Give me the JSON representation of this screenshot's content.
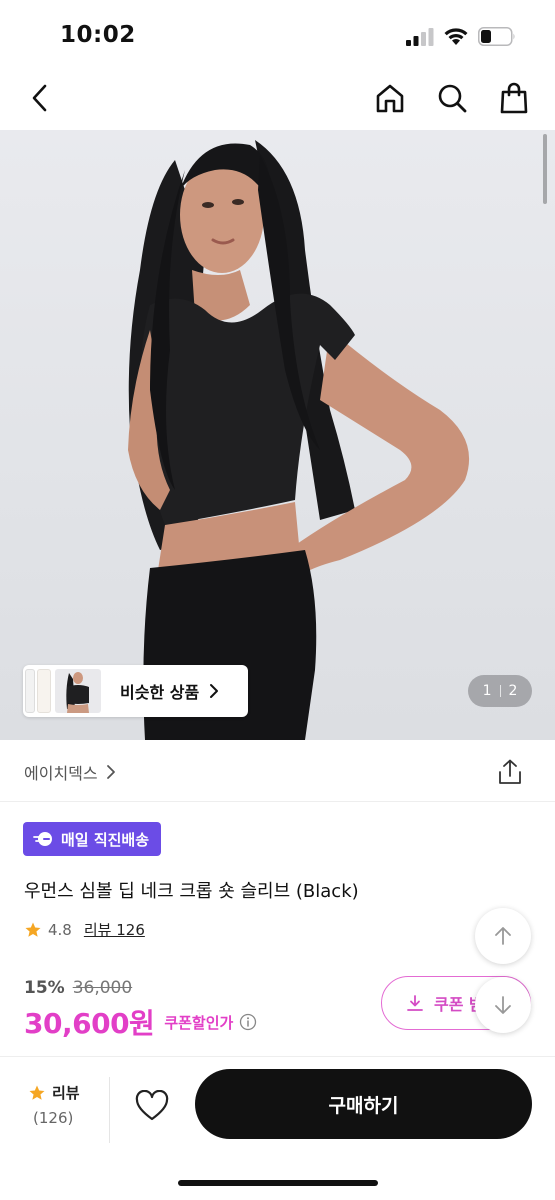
{
  "status_bar": {
    "time": "10:02"
  },
  "nav": {
    "icons": [
      "chevron-left-icon",
      "home-icon",
      "search-icon",
      "shopping-bag-icon"
    ]
  },
  "gallery": {
    "similar_label": "비슷한 상품",
    "page_current": "1",
    "page_total": "2"
  },
  "brand": {
    "name": "에이치덱스"
  },
  "product": {
    "delivery_badge": "매일 직진배송",
    "title": "우먼스 심볼 딥 네크 크롭 숏 슬리브 (Black)",
    "rating": "4.8",
    "review_link": "리뷰 126"
  },
  "price": {
    "discount_rate": "15%",
    "original": "36,000",
    "final": "30,600원",
    "coupon_label": "쿠폰할인가",
    "coupon_button": "쿠폰 받"
  },
  "bottom_bar": {
    "review_label": "리뷰",
    "review_count": "(126)",
    "buy_label": "구매하기"
  },
  "colors": {
    "accent_pink": "#e23fc7",
    "badge_purple": "#6b4ce6",
    "star": "#f5a623",
    "buy_button": "#111111"
  }
}
